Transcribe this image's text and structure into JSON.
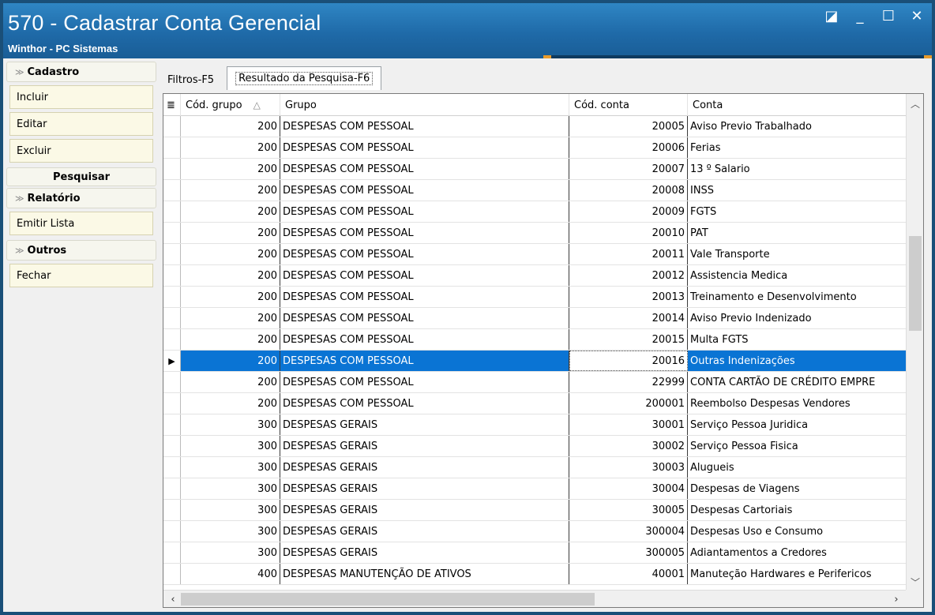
{
  "window": {
    "title": "570 - Cadastrar Conta Gerencial",
    "subtitle": "Winthor - PC Sistemas",
    "controls": [
      "◪",
      "_",
      "☐",
      "✕"
    ]
  },
  "sidebar": {
    "cadastro_header": "Cadastro",
    "incluir": "Incluir",
    "editar": "Editar",
    "excluir": "Excluir",
    "pesquisar": "Pesquisar",
    "relatorio_header": "Relatório",
    "emitir_lista": "Emitir Lista",
    "outros_header": "Outros",
    "fechar": "Fechar"
  },
  "tabs": {
    "filtros": "Filtros-F5",
    "resultado": "Resultado da Pesquisa-F6"
  },
  "grid": {
    "columns": {
      "cod_grupo": "Cód. grupo",
      "grupo": "Grupo",
      "cod_conta": "Cód. conta",
      "conta": "Conta"
    },
    "selected_index": 11,
    "rows": [
      {
        "cod_grupo": "200",
        "grupo": "DESPESAS COM PESSOAL",
        "cod_conta": "20005",
        "conta": "Aviso Previo Trabalhado"
      },
      {
        "cod_grupo": "200",
        "grupo": "DESPESAS COM PESSOAL",
        "cod_conta": "20006",
        "conta": "Ferias"
      },
      {
        "cod_grupo": "200",
        "grupo": "DESPESAS COM PESSOAL",
        "cod_conta": "20007",
        "conta": "13 º Salario"
      },
      {
        "cod_grupo": "200",
        "grupo": "DESPESAS COM PESSOAL",
        "cod_conta": "20008",
        "conta": "INSS"
      },
      {
        "cod_grupo": "200",
        "grupo": "DESPESAS COM PESSOAL",
        "cod_conta": "20009",
        "conta": "FGTS"
      },
      {
        "cod_grupo": "200",
        "grupo": "DESPESAS COM PESSOAL",
        "cod_conta": "20010",
        "conta": "PAT"
      },
      {
        "cod_grupo": "200",
        "grupo": "DESPESAS COM PESSOAL",
        "cod_conta": "20011",
        "conta": "Vale Transporte"
      },
      {
        "cod_grupo": "200",
        "grupo": "DESPESAS COM PESSOAL",
        "cod_conta": "20012",
        "conta": "Assistencia Medica"
      },
      {
        "cod_grupo": "200",
        "grupo": "DESPESAS COM PESSOAL",
        "cod_conta": "20013",
        "conta": "Treinamento e Desenvolvimento"
      },
      {
        "cod_grupo": "200",
        "grupo": "DESPESAS COM PESSOAL",
        "cod_conta": "20014",
        "conta": "Aviso Previo Indenizado"
      },
      {
        "cod_grupo": "200",
        "grupo": "DESPESAS COM PESSOAL",
        "cod_conta": "20015",
        "conta": "Multa FGTS"
      },
      {
        "cod_grupo": "200",
        "grupo": "DESPESAS COM PESSOAL",
        "cod_conta": "20016",
        "conta": "Outras Indenizações"
      },
      {
        "cod_grupo": "200",
        "grupo": "DESPESAS COM PESSOAL",
        "cod_conta": "22999",
        "conta": "CONTA CARTÃO DE CRÉDITO EMPRE"
      },
      {
        "cod_grupo": "200",
        "grupo": "DESPESAS COM PESSOAL",
        "cod_conta": "200001",
        "conta": "Reembolso Despesas Vendores"
      },
      {
        "cod_grupo": "300",
        "grupo": "DESPESAS GERAIS",
        "cod_conta": "30001",
        "conta": "Serviço Pessoa Juridica"
      },
      {
        "cod_grupo": "300",
        "grupo": "DESPESAS GERAIS",
        "cod_conta": "30002",
        "conta": "Serviço Pessoa Fisica"
      },
      {
        "cod_grupo": "300",
        "grupo": "DESPESAS GERAIS",
        "cod_conta": "30003",
        "conta": "Alugueis"
      },
      {
        "cod_grupo": "300",
        "grupo": "DESPESAS GERAIS",
        "cod_conta": "30004",
        "conta": "Despesas de Viagens"
      },
      {
        "cod_grupo": "300",
        "grupo": "DESPESAS GERAIS",
        "cod_conta": "30005",
        "conta": "Despesas Cartoriais"
      },
      {
        "cod_grupo": "300",
        "grupo": "DESPESAS GERAIS",
        "cod_conta": "300004",
        "conta": "Despesas Uso e Consumo"
      },
      {
        "cod_grupo": "300",
        "grupo": "DESPESAS GERAIS",
        "cod_conta": "300005",
        "conta": "Adiantamentos a Credores"
      },
      {
        "cod_grupo": "400",
        "grupo": "DESPESAS MANUTENÇÃO DE ATIVOS",
        "cod_conta": "40001",
        "conta": "Manuteção Hardwares e Perifericos"
      }
    ]
  },
  "colors": {
    "titlebar": "#1f6aa8",
    "selection": "#0a74d4"
  }
}
